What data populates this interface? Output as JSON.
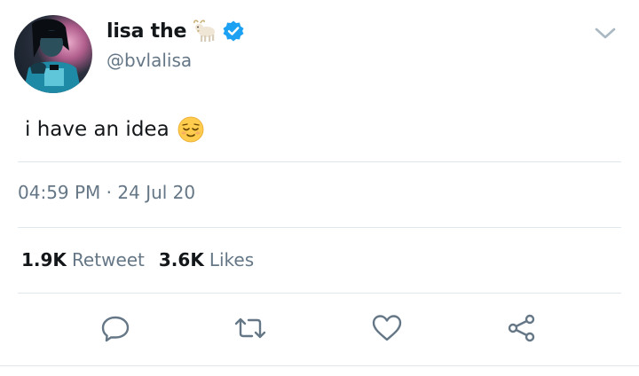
{
  "author": {
    "display_name": "lisa the",
    "handle": "@bvlalisa",
    "name_emoji": "goat-icon",
    "verified": true
  },
  "tweet": {
    "text": "i have an idea",
    "trailing_emoji": "relieved-face-emoji"
  },
  "meta": {
    "timestamp": "04:59 PM · 24 Jul 20"
  },
  "stats": {
    "retweet_count": "1.9K",
    "retweet_label": "Retweet",
    "like_count": "3.6K",
    "like_label": "Likes"
  },
  "actions": [
    "reply-icon",
    "retweet-icon",
    "like-icon",
    "share-icon"
  ],
  "colors": {
    "text_primary": "#14171a",
    "text_secondary": "#657786",
    "verified_blue": "#1da1f2",
    "divider": "#e1e8ed"
  }
}
